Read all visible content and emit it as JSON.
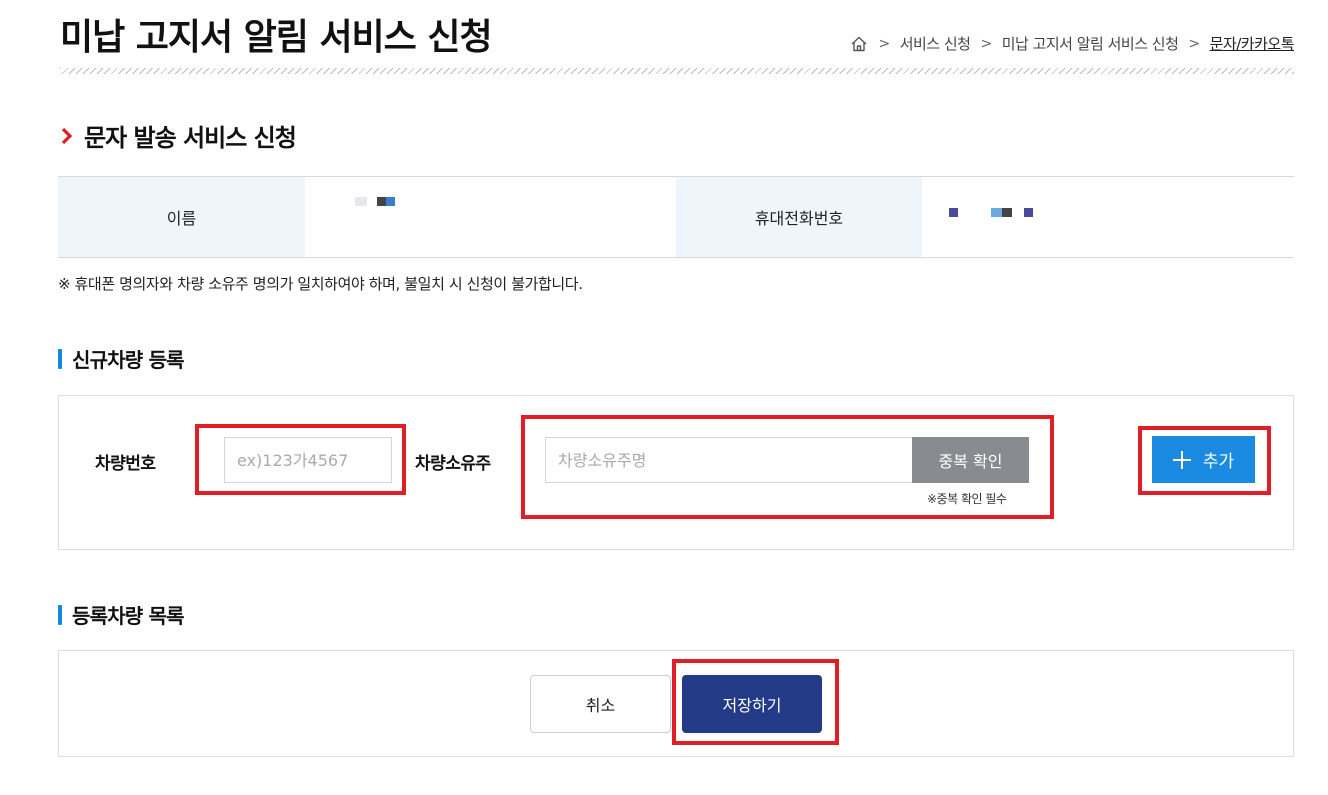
{
  "page": {
    "title": "미납 고지서 알림 서비스 신청"
  },
  "breadcrumb": {
    "separator": ">",
    "items": [
      "서비스 신청",
      "미납 고지서 알림 서비스 신청"
    ],
    "current": "문자/카카오톡"
  },
  "section": {
    "title": "문자 발송 서비스 신청"
  },
  "info": {
    "name_label": "이름",
    "phone_label": "휴대전화번호"
  },
  "notice": "※ 휴대폰 명의자와 차량 소유주 명의가 일치하여야 하며, 불일치 시 신청이 불가합니다.",
  "register": {
    "title": "신규차량 등록",
    "car_number_label": "차량번호",
    "car_number_placeholder": "ex)123가4567",
    "owner_label": "차량소유주",
    "owner_placeholder": "차량소유주명",
    "dup_check_label": "중복 확인",
    "dup_note": "※중복 확인 필수",
    "add_label": "추가"
  },
  "list": {
    "title": "등록차량 목록"
  },
  "actions": {
    "cancel_label": "취소",
    "save_label": "저장하기"
  },
  "colors": {
    "accent": "#1a8be0",
    "primary": "#233a86",
    "highlight": "#e01e25",
    "header_cell": "#eef6fc"
  },
  "icons": {
    "home": "home-icon",
    "section": "chevron-right-icon",
    "add": "plus-icon"
  }
}
